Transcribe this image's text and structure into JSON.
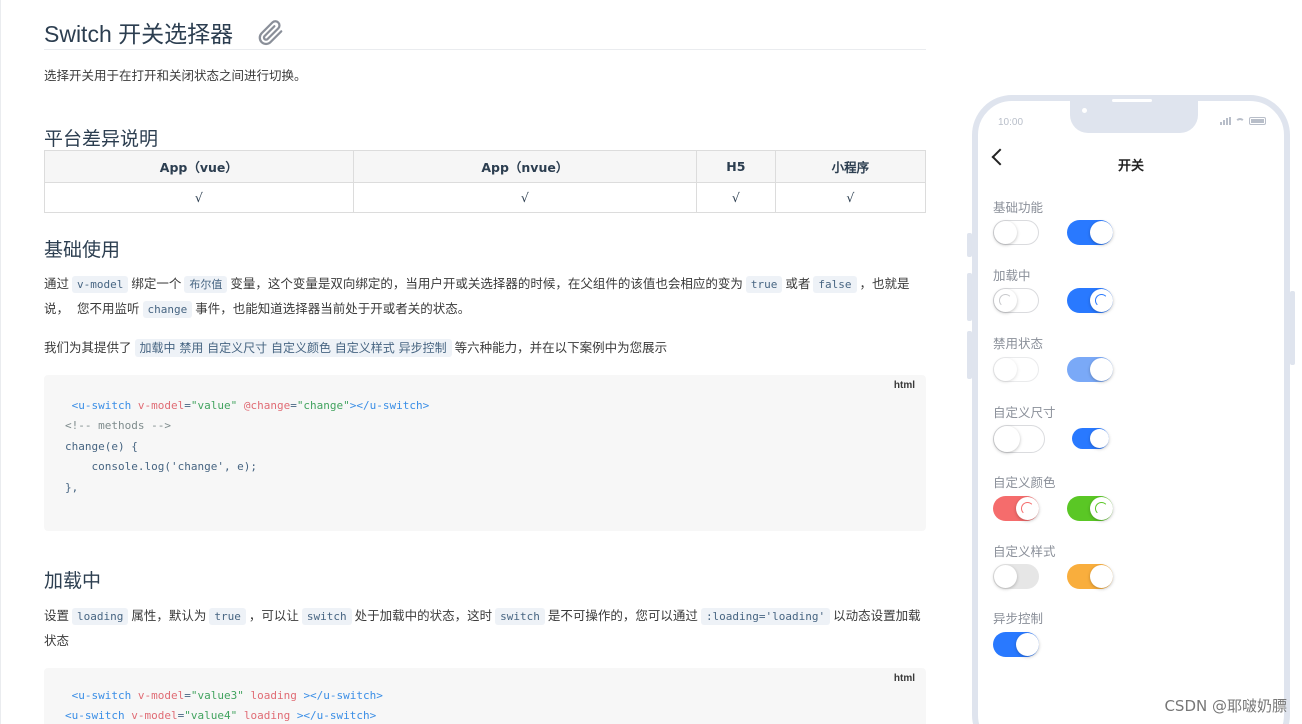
{
  "page": {
    "title": "Switch 开关选择器",
    "clip_icon": "paperclip-icon",
    "intro": "选择开关用于在打开和关闭状态之间进行切换。"
  },
  "platform": {
    "heading": "平台差异说明",
    "columns": [
      "App（vue）",
      "App（nvue）",
      "H5",
      "小程序"
    ],
    "row": [
      "√",
      "√",
      "√",
      "√"
    ]
  },
  "basic": {
    "heading": "基础使用",
    "p1": [
      "通过",
      "v-model",
      "绑定一个",
      "布尔值",
      "变量，这个变量是双向绑定的，当用户开或关选择器的时候，在父组件的该值也会相应的变为",
      "true",
      "或者",
      "false",
      "，也就是"
    ],
    "p1b": [
      "说，",
      "您不用监听",
      "change",
      "事件，也能知道选择器当前处于开或者关的状态。"
    ],
    "p2": [
      "我们为其提供了",
      "加载中 禁用 自定义尺寸 自定义颜色 自定义样式 异步控制",
      "等六种能力，并在以下案例中为您展示"
    ],
    "code_lang": "html",
    "code": [
      " <u-switch v-model=\"value\" @change=\"change\"></u-switch>",
      "<!-- methods -->",
      "change(e) {",
      "    console.log('change', e);",
      "},"
    ]
  },
  "loading": {
    "heading": "加载中",
    "p1": [
      "设置",
      "loading",
      "属性，默认为",
      "true",
      "，可以让",
      "switch",
      "处于加载中的状态，这时",
      "switch",
      "是不可操作的，您可以通过",
      ":loading='loading'",
      "以动态设置加载"
    ],
    "p1b": "状态",
    "code_lang": "html",
    "code": [
      " <u-switch v-model=\"value3\" loading ></u-switch>",
      "<u-switch v-model=\"value4\" loading ></u-switch>"
    ]
  },
  "phone": {
    "time": "10:00",
    "nav_title": "开关",
    "sections": [
      "基础功能",
      "加载中",
      "禁用状态",
      "自定义尺寸",
      "自定义颜色",
      "自定义样式",
      "异步控制"
    ],
    "switch_states": {
      "basic": [
        false,
        true
      ],
      "loading": [
        false,
        true
      ],
      "disabled": [
        false,
        true
      ],
      "size": [
        false,
        true
      ],
      "color": [
        true,
        true
      ],
      "style": [
        false,
        true
      ],
      "async": [
        true
      ]
    },
    "colors": {
      "primary": "#2979ff",
      "disabled_on": "#7aa9f7",
      "red": "#f56c6c",
      "green": "#5ac725",
      "orange": "#f9ae3d",
      "gray_track": "#e6e6e6"
    }
  },
  "watermark": "CSDN @耶啵奶膘"
}
